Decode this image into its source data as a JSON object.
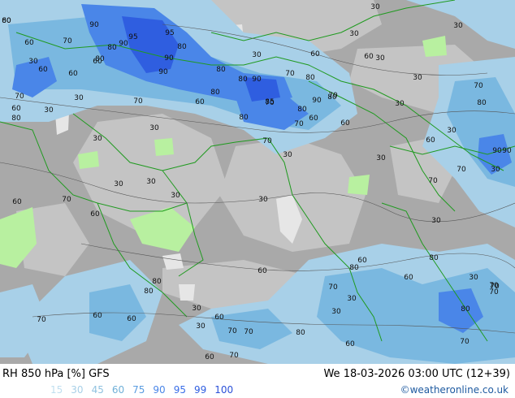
{
  "footer": {
    "title": "RH 850 hPa [%] GFS",
    "time": "We 18-03-2026 03:00 UTC (12+39)",
    "credit": "©weatheronline.co.uk",
    "legend": [
      {
        "label": "15",
        "color": "#c0dff0"
      },
      {
        "label": "30",
        "color": "#a8d0e8"
      },
      {
        "label": "45",
        "color": "#90c2e0"
      },
      {
        "label": "60",
        "color": "#70b0d8"
      },
      {
        "label": "75",
        "color": "#5a9ce0"
      },
      {
        "label": "90",
        "color": "#4a86e8"
      },
      {
        "label": "95",
        "color": "#3a6ee8"
      },
      {
        "label": "99",
        "color": "#2f5ee0"
      },
      {
        "label": "100",
        "color": "#2a50d8"
      }
    ]
  },
  "contour_labels": [
    "80",
    "90",
    "95",
    "95",
    "30",
    "30",
    "30",
    "60",
    "70",
    "80",
    "80",
    "90",
    "60",
    "30",
    "80",
    "30",
    "60",
    "60",
    "80",
    "90",
    "90",
    "70",
    "80",
    "80",
    "90",
    "80",
    "30",
    "60",
    "60",
    "70",
    "60",
    "80",
    "30",
    "70",
    "90",
    "80",
    "60",
    "30",
    "70",
    "30",
    "70",
    "80",
    "90",
    "85",
    "80",
    "30",
    "70",
    "30",
    "60",
    "80",
    "70",
    "60",
    "30",
    "70",
    "90",
    "30",
    "30",
    "30",
    "70",
    "60",
    "30",
    "60",
    "70",
    "30",
    "30",
    "30",
    "60",
    "30",
    "30",
    "60",
    "80",
    "70",
    "30",
    "60",
    "70",
    "80",
    "80",
    "70",
    "60",
    "60",
    "70",
    "60",
    "30",
    "30",
    "70",
    "70",
    "60",
    "70",
    "60",
    "30",
    "80",
    "60",
    "70",
    "80",
    "70",
    "80",
    "30",
    "70",
    "60"
  ]
}
